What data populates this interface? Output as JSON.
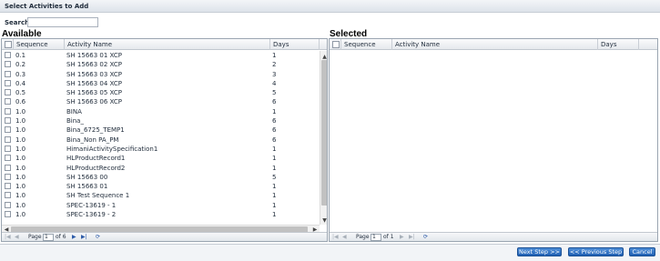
{
  "dialog": {
    "title": "Select Activities to Add"
  },
  "search": {
    "label": "Search",
    "value": ""
  },
  "available": {
    "title": "Available",
    "columns": {
      "sequence": "Sequence",
      "name": "Activity Name",
      "days": "Days"
    },
    "rows": [
      {
        "seq": "0.1",
        "name": "SH 15663 01 XCP",
        "days": "1"
      },
      {
        "seq": "0.2",
        "name": "SH 15663 02 XCP",
        "days": "2"
      },
      {
        "seq": "0.3",
        "name": "SH 15663 03 XCP",
        "days": "3"
      },
      {
        "seq": "0.4",
        "name": "SH 15663 04 XCP",
        "days": "4"
      },
      {
        "seq": "0.5",
        "name": "SH 15663 05 XCP",
        "days": "5"
      },
      {
        "seq": "0.6",
        "name": "SH 15663 06 XCP",
        "days": "6"
      },
      {
        "seq": "1.0",
        "name": "BINA",
        "days": "1"
      },
      {
        "seq": "1.0",
        "name": "Bina_",
        "days": "6"
      },
      {
        "seq": "1.0",
        "name": "Bina_6725_TEMP1",
        "days": "6"
      },
      {
        "seq": "1.0",
        "name": "Bina_Non PA_PM",
        "days": "6"
      },
      {
        "seq": "1.0",
        "name": "HimaniActivitySpecification1",
        "days": "1"
      },
      {
        "seq": "1.0",
        "name": "HLProductRecord1",
        "days": "1"
      },
      {
        "seq": "1.0",
        "name": "HLProductRecord2",
        "days": "1"
      },
      {
        "seq": "1.0",
        "name": "SH 15663 00",
        "days": "5"
      },
      {
        "seq": "1.0",
        "name": "SH 15663 01",
        "days": "1"
      },
      {
        "seq": "1.0",
        "name": "SH Test Sequence 1",
        "days": "1"
      },
      {
        "seq": "1.0",
        "name": "SPEC-13619 - 1",
        "days": "1"
      },
      {
        "seq": "1.0",
        "name": "SPEC-13619 - 2",
        "days": "1"
      }
    ],
    "pager": {
      "page_label": "Page",
      "page_value": "1",
      "of_label": "of 6"
    }
  },
  "selected": {
    "title": "Selected",
    "columns": {
      "sequence": "Sequence",
      "name": "Activity Name",
      "days": "Days"
    },
    "rows": [],
    "pager": {
      "page_label": "Page",
      "page_value": "1",
      "of_label": "of 1"
    }
  },
  "buttons": {
    "next": "Next Step >>",
    "previous": "<< Previous Step",
    "cancel": "Cancel"
  },
  "icons": {
    "first": "first-page-icon",
    "prev": "prev-page-icon",
    "next": "next-page-icon",
    "last": "last-page-icon",
    "refresh": "refresh-icon"
  }
}
